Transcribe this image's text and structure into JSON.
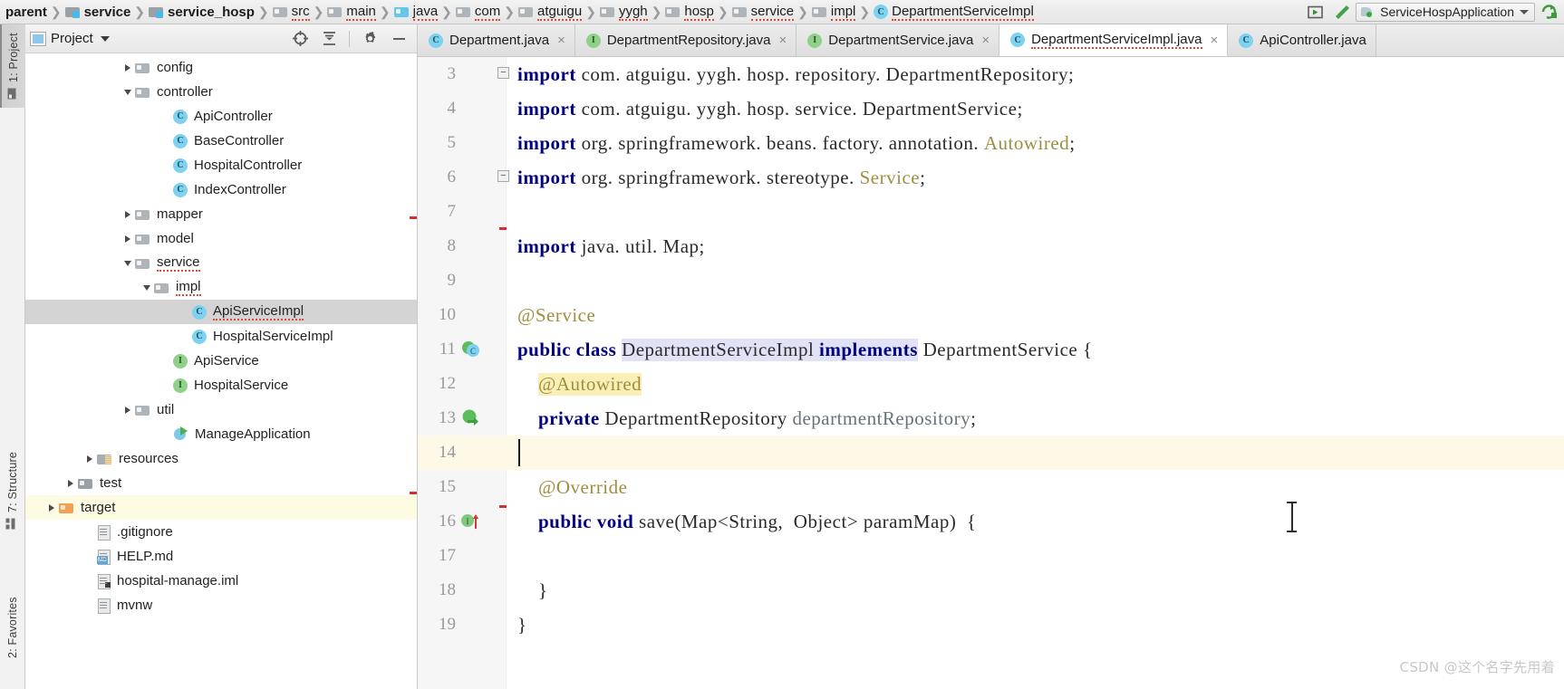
{
  "navbar": {
    "breadcrumbs": [
      {
        "label": "parent",
        "icon": "none",
        "bold": true,
        "spell": false
      },
      {
        "label": "service",
        "icon": "module-folder-icon",
        "bold": true,
        "spell": false
      },
      {
        "label": "service_hosp",
        "icon": "module-folder-icon",
        "bold": true,
        "spell": false
      },
      {
        "label": "src",
        "icon": "folder-icon",
        "bold": false,
        "spell": true
      },
      {
        "label": "main",
        "icon": "folder-icon",
        "bold": false,
        "spell": true
      },
      {
        "label": "java",
        "icon": "source-folder-icon",
        "bold": false,
        "spell": true
      },
      {
        "label": "com",
        "icon": "folder-icon",
        "bold": false,
        "spell": true
      },
      {
        "label": "atguigu",
        "icon": "folder-icon",
        "bold": false,
        "spell": true
      },
      {
        "label": "yygh",
        "icon": "folder-icon",
        "bold": false,
        "spell": true
      },
      {
        "label": "hosp",
        "icon": "folder-icon",
        "bold": false,
        "spell": true
      },
      {
        "label": "service",
        "icon": "folder-icon",
        "bold": false,
        "spell": true
      },
      {
        "label": "impl",
        "icon": "folder-icon",
        "bold": false,
        "spell": true
      },
      {
        "label": "DepartmentServiceImpl",
        "icon": "class-icon",
        "bold": false,
        "spell": true
      }
    ],
    "run_button": "run-icon",
    "build_button": "build-hammer-icon",
    "run_config": "ServiceHospApplication",
    "rerun_button": "rerun-icon"
  },
  "tool_strips": {
    "left": [
      {
        "label": "1: Project",
        "active": true,
        "icon": "project-folder-icon"
      },
      {
        "label": "7: Structure",
        "active": false,
        "icon": "structure-icon"
      },
      {
        "label": "2: Favorites",
        "active": false,
        "icon": "favorites-icon"
      }
    ]
  },
  "project_panel": {
    "title": "Project",
    "dropdown": "chevron-down-icon",
    "tools": [
      "locate-target-icon",
      "collapse-all-icon",
      "settings-gear-icon",
      "hide-minimize-icon"
    ],
    "tree": [
      {
        "label": "config",
        "indent": 5,
        "arrow": "right",
        "icon": "folder-icon",
        "state": "normal",
        "spell": false
      },
      {
        "label": "controller",
        "indent": 5,
        "arrow": "down",
        "icon": "folder-icon",
        "state": "normal",
        "spell": false
      },
      {
        "label": "ApiController",
        "indent": 7,
        "arrow": "none",
        "icon": "class-icon",
        "state": "normal",
        "spell": false
      },
      {
        "label": "BaseController",
        "indent": 7,
        "arrow": "none",
        "icon": "class-icon",
        "state": "normal",
        "spell": false
      },
      {
        "label": "HospitalController",
        "indent": 7,
        "arrow": "none",
        "icon": "class-icon",
        "state": "normal",
        "spell": false
      },
      {
        "label": "IndexController",
        "indent": 7,
        "arrow": "none",
        "icon": "class-icon",
        "state": "normal",
        "spell": false
      },
      {
        "label": "mapper",
        "indent": 5,
        "arrow": "right",
        "icon": "folder-icon",
        "state": "normal",
        "spell": false
      },
      {
        "label": "model",
        "indent": 5,
        "arrow": "right",
        "icon": "folder-icon",
        "state": "normal",
        "spell": false
      },
      {
        "label": "service",
        "indent": 5,
        "arrow": "down",
        "icon": "folder-icon",
        "state": "normal",
        "spell": true
      },
      {
        "label": "impl",
        "indent": 6,
        "arrow": "down",
        "icon": "folder-icon",
        "state": "normal",
        "spell": true
      },
      {
        "label": "ApiServiceImpl",
        "indent": 8,
        "arrow": "none",
        "icon": "class-icon",
        "state": "selected",
        "spell": true
      },
      {
        "label": "HospitalServiceImpl",
        "indent": 8,
        "arrow": "none",
        "icon": "class-icon",
        "state": "normal",
        "spell": false
      },
      {
        "label": "ApiService",
        "indent": 7,
        "arrow": "none",
        "icon": "interface-icon",
        "state": "normal",
        "spell": false
      },
      {
        "label": "HospitalService",
        "indent": 7,
        "arrow": "none",
        "icon": "interface-icon",
        "state": "normal",
        "spell": false
      },
      {
        "label": "util",
        "indent": 5,
        "arrow": "right",
        "icon": "folder-icon",
        "state": "normal",
        "spell": false
      },
      {
        "label": "ManageApplication",
        "indent": 7,
        "arrow": "none",
        "icon": "spring-boot-icon",
        "state": "normal",
        "spell": false
      },
      {
        "label": "resources",
        "indent": 3,
        "arrow": "right",
        "icon": "resources-folder-icon",
        "state": "normal",
        "spell": false
      },
      {
        "label": "test",
        "indent": 2,
        "arrow": "right",
        "icon": "test-folder-icon",
        "state": "normal",
        "spell": false
      },
      {
        "label": "target",
        "indent": 1,
        "arrow": "right",
        "icon": "excluded-folder-icon",
        "state": "highlighted",
        "spell": false
      },
      {
        "label": ".gitignore",
        "indent": 3,
        "arrow": "none",
        "icon": "file-icon",
        "state": "normal",
        "spell": false
      },
      {
        "label": "HELP.md",
        "indent": 3,
        "arrow": "none",
        "icon": "markdown-file-icon",
        "state": "normal",
        "spell": false
      },
      {
        "label": "hospital-manage.iml",
        "indent": 3,
        "arrow": "none",
        "icon": "iml-file-icon",
        "state": "normal",
        "spell": false
      },
      {
        "label": "mvnw",
        "indent": 3,
        "arrow": "none",
        "icon": "file-icon",
        "state": "normal",
        "spell": false
      }
    ]
  },
  "editor": {
    "tabs": [
      {
        "label": "Department.java",
        "icon": "class-icon",
        "active": false,
        "spell": false,
        "closable": true
      },
      {
        "label": "DepartmentRepository.java",
        "icon": "interface-icon",
        "active": false,
        "spell": false,
        "closable": true
      },
      {
        "label": "DepartmentService.java",
        "icon": "interface-icon",
        "active": false,
        "spell": false,
        "closable": true
      },
      {
        "label": "DepartmentServiceImpl.java",
        "icon": "class-icon",
        "active": true,
        "spell": true,
        "closable": true
      },
      {
        "label": "ApiController.java",
        "icon": "class-icon",
        "active": false,
        "spell": false,
        "closable": false
      }
    ],
    "lines": [
      {
        "num": "3",
        "gutter_icon": "fold-start",
        "caret": false,
        "tokens": [
          {
            "t": "import",
            "c": "kw"
          },
          {
            "t": " com. atguigu. yygh. hosp. repository. DepartmentRepository;",
            "c": "ident"
          }
        ]
      },
      {
        "num": "4",
        "gutter_icon": "",
        "caret": false,
        "tokens": [
          {
            "t": "import",
            "c": "kw"
          },
          {
            "t": " com. atguigu. yygh. hosp. service. DepartmentService;",
            "c": "ident"
          }
        ]
      },
      {
        "num": "5",
        "gutter_icon": "",
        "caret": false,
        "tokens": [
          {
            "t": "import",
            "c": "kw"
          },
          {
            "t": " org. springframework. beans. factory. annotation. ",
            "c": "ident"
          },
          {
            "t": "Autowired",
            "c": "anno"
          },
          {
            "t": ";",
            "c": "ident"
          }
        ]
      },
      {
        "num": "6",
        "gutter_icon": "fold-end",
        "caret": false,
        "tokens": [
          {
            "t": "import",
            "c": "kw"
          },
          {
            "t": " org. springframework. stereotype. ",
            "c": "ident"
          },
          {
            "t": "Service",
            "c": "anno"
          },
          {
            "t": ";",
            "c": "ident"
          }
        ]
      },
      {
        "num": "7",
        "gutter_icon": "",
        "caret": false,
        "tokens": []
      },
      {
        "num": "8",
        "gutter_icon": "",
        "caret": false,
        "tokens": [
          {
            "t": "import",
            "c": "kw"
          },
          {
            "t": " java. util. Map;",
            "c": "ident"
          }
        ]
      },
      {
        "num": "9",
        "gutter_icon": "",
        "caret": false,
        "tokens": []
      },
      {
        "num": "10",
        "gutter_icon": "",
        "caret": false,
        "tokens": [
          {
            "t": "@Service",
            "c": "anno"
          }
        ]
      },
      {
        "num": "11",
        "gutter_icon": "class-marker",
        "caret": false,
        "tokens": [
          {
            "t": "public class ",
            "c": "kw"
          },
          {
            "t": "DepartmentServiceImpl",
            "c": "ident hl-purple"
          },
          {
            "t": " ",
            "c": "ident hl-purple"
          },
          {
            "t": "implements",
            "c": "kw hl-purple"
          },
          {
            "t": " DepartmentService {",
            "c": "ident"
          }
        ]
      },
      {
        "num": "12",
        "gutter_icon": "",
        "caret": false,
        "tokens": [
          {
            "t": "    ",
            "c": "ident"
          },
          {
            "t": "@Autowired",
            "c": "anno hl-yellow"
          }
        ]
      },
      {
        "num": "13",
        "gutter_icon": "implementing-marker",
        "caret": false,
        "tokens": [
          {
            "t": "    ",
            "c": "ident"
          },
          {
            "t": "private",
            "c": "kw"
          },
          {
            "t": " DepartmentRepository ",
            "c": "ident"
          },
          {
            "t": "departmentRepository",
            "c": "field"
          },
          {
            "t": ";",
            "c": "ident"
          }
        ]
      },
      {
        "num": "14",
        "gutter_icon": "",
        "caret": true,
        "tokens": []
      },
      {
        "num": "15",
        "gutter_icon": "",
        "caret": false,
        "tokens": [
          {
            "t": "    ",
            "c": "ident"
          },
          {
            "t": "@Override",
            "c": "anno"
          }
        ]
      },
      {
        "num": "16",
        "gutter_icon": "override-marker",
        "caret": false,
        "tokens": [
          {
            "t": "    ",
            "c": "ident"
          },
          {
            "t": "public void ",
            "c": "kw"
          },
          {
            "t": "save",
            "c": "ident"
          },
          {
            "t": "(Map<String,  Object> paramMap)  {",
            "c": "ident"
          }
        ]
      },
      {
        "num": "17",
        "gutter_icon": "",
        "caret": false,
        "tokens": []
      },
      {
        "num": "18",
        "gutter_icon": "",
        "caret": false,
        "tokens": [
          {
            "t": "    }",
            "c": "ident"
          }
        ]
      },
      {
        "num": "19",
        "gutter_icon": "",
        "caret": false,
        "tokens": [
          {
            "t": "}",
            "c": "ident"
          }
        ]
      }
    ]
  },
  "watermark": "CSDN @这个名字先用着",
  "colors": {
    "keyword": "#000080",
    "annotation": "#9e8f3e",
    "field": "#66737a",
    "selection_purple": "#e2e2f7",
    "highlight_yellow": "#fbeeb6",
    "caret_line": "#fdf9e6",
    "tree_selected": "#d4d4d4",
    "tree_highlight": "#fdfbe2",
    "error_stripe": "#d0302f"
  }
}
